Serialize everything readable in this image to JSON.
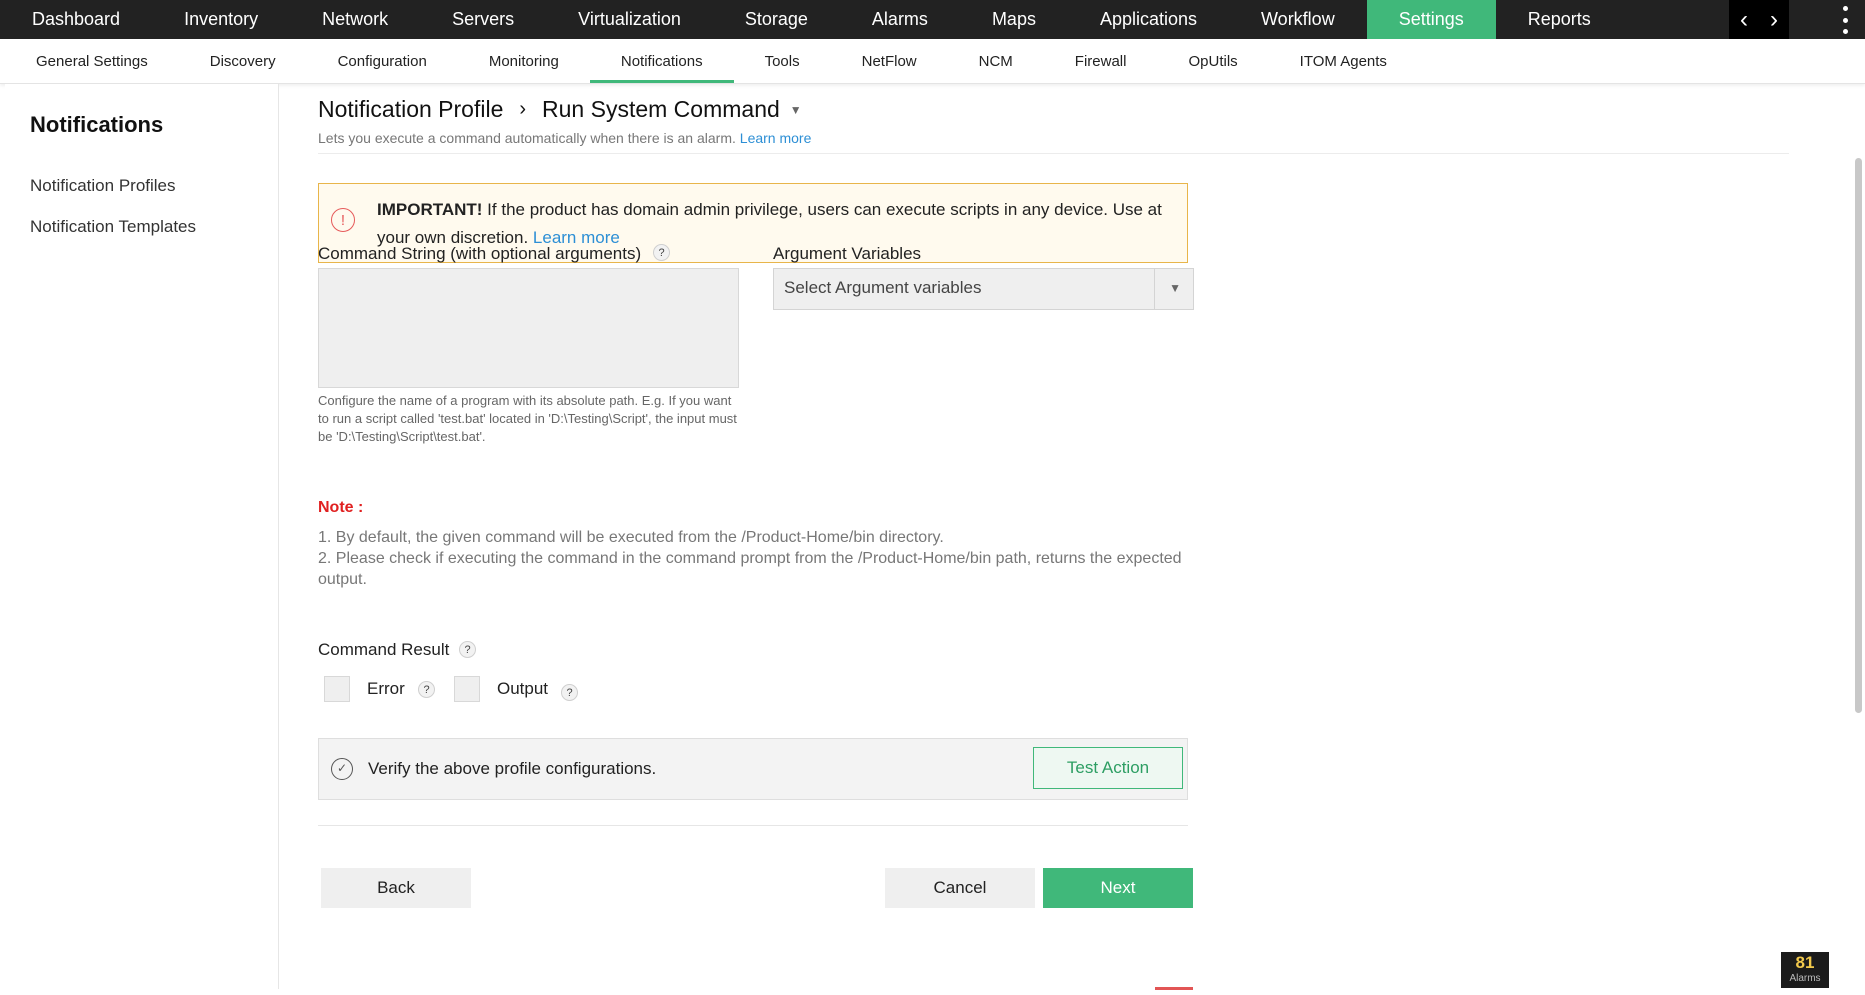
{
  "topnav": {
    "items": [
      "Dashboard",
      "Inventory",
      "Network",
      "Servers",
      "Virtualization",
      "Storage",
      "Alarms",
      "Maps",
      "Applications",
      "Workflow",
      "Settings",
      "Reports"
    ],
    "active": "Settings"
  },
  "subnav": {
    "items": [
      "General Settings",
      "Discovery",
      "Configuration",
      "Monitoring",
      "Notifications",
      "Tools",
      "NetFlow",
      "NCM",
      "Firewall",
      "OpUtils",
      "ITOM Agents"
    ],
    "active": "Notifications"
  },
  "sidebar": {
    "title": "Notifications",
    "links": [
      "Notification Profiles",
      "Notification Templates"
    ]
  },
  "header": {
    "crumb_parent": "Notification Profile",
    "crumb_sep": "›",
    "crumb_current": "Run System Command",
    "subtitle": "Lets you execute a command automatically when there is an alarm.",
    "subtitle_link": "Learn more"
  },
  "warning": {
    "label": "IMPORTANT!",
    "text": " If the product has domain admin privilege, users can execute scripts in any device. Use at your own discretion. ",
    "link": "Learn more"
  },
  "form": {
    "command_label": "Command String (with optional arguments)",
    "command_value": "",
    "command_help": "Configure the name of a program with its absolute path. E.g. If you want to run a script called 'test.bat' located in 'D:\\Testing\\Script', the input must be 'D:\\Testing\\Script\\test.bat'.",
    "arg_label": "Argument Variables",
    "arg_placeholder": "Select Argument variables",
    "note_title": "Note :",
    "note_lines": [
      "1. By default, the given command will be executed from the /Product-Home/bin directory.",
      "2. Please check if executing the command in the command prompt from the /Product-Home/bin path, returns the expected output."
    ],
    "result_label": "Command Result",
    "error_label": "Error",
    "output_label": "Output",
    "error_checked": false,
    "output_checked": false
  },
  "verify": {
    "text": "Verify the above profile configurations.",
    "button": "Test Action"
  },
  "actions": {
    "back": "Back",
    "cancel": "Cancel",
    "next": "Next"
  },
  "alarm_badge": {
    "count": "81",
    "label": "Alarms"
  },
  "colors": {
    "accent": "#40b87a",
    "link": "#2d8fd5",
    "note_red": "#e02020",
    "warn_border": "#e8b54a"
  }
}
